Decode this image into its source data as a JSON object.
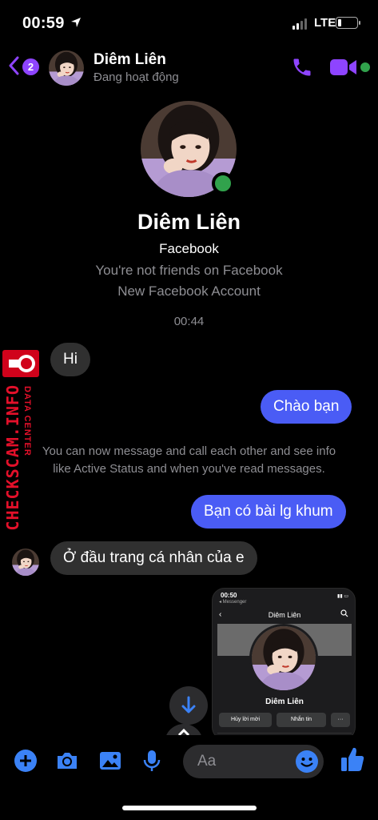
{
  "status_bar": {
    "time": "00:59",
    "network": "LTE",
    "battery_level": 0.2
  },
  "header": {
    "unread_count": "2",
    "name": "Diêm Liên",
    "status": "Đang hoạt động"
  },
  "profile": {
    "name": "Diêm Liên",
    "platform": "Facebook",
    "line1": "You're not friends on Facebook",
    "line2": "New Facebook Account"
  },
  "timestamp": "00:44",
  "messages": {
    "hi": "Hi",
    "chao_ban": "Chào bạn",
    "system_line1": "You can now message and call each other and see info",
    "system_line2": "like Active Status and when you've read messages.",
    "ban_co": "Bạn có bài lg khum",
    "o_dau": "Ở đầu trang cá nhân của e"
  },
  "watermark": {
    "main": "CHECKSCAM.INFO",
    "sub": "DATA CENTER"
  },
  "shared_screenshot": {
    "time": "00:50",
    "back_label": "◂ Messenger",
    "title": "Diêm Liên",
    "name": "Diêm Liên",
    "btn_cancel": "Hủy lời mời",
    "btn_message": "Nhắn tin",
    "btn_more": "···"
  },
  "composer": {
    "placeholder": "Aa"
  },
  "colors": {
    "accent": "#8e44ff",
    "outgoing_bubble": "#4a5cf5",
    "incoming_bubble": "#303030",
    "online": "#31a24c",
    "icon_blue": "#3b82f6"
  }
}
